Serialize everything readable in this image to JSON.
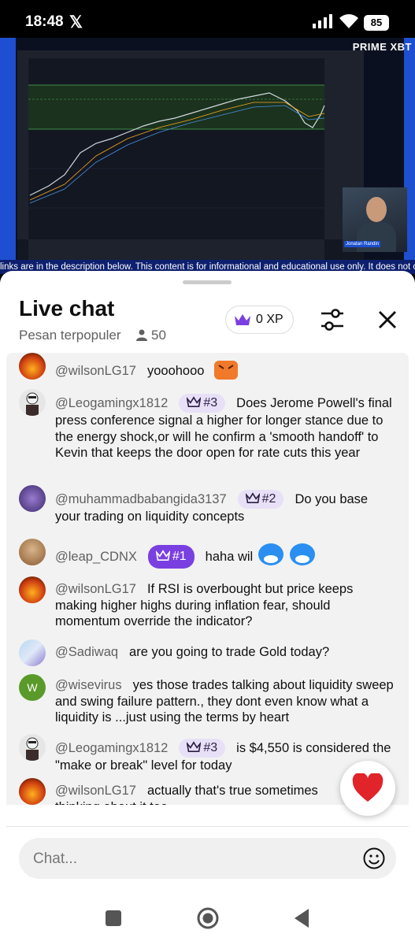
{
  "status_bar": {
    "time": "18:48",
    "battery": "85"
  },
  "video": {
    "brand": "PRIME XBT",
    "ticker": "links are in the description below. This content is for informational and educational use only. It does not con",
    "presenter_name": "Jonatan Randin"
  },
  "chat": {
    "title": "Live chat",
    "filter_label": "Pesan terpopuler",
    "viewer_count": "50",
    "xp_label": "0 XP",
    "messages": [
      {
        "author": "@wilsonLG17",
        "badge": "",
        "text": "yooohooo"
      },
      {
        "author": "@Leogamingx1812",
        "badge": "#3",
        "text": "Does Jerome Powell's final press conference signal a higher for longer stance due to the energy shock,or will he confirm a 'smooth handoff' to Kevin that keeps the door open for rate cuts this year"
      },
      {
        "author": "@muhammadbabangida3137",
        "badge": "#2",
        "text": "Do you base your trading on liquidity concepts"
      },
      {
        "author": "@leap_CDNX",
        "badge": "#1",
        "text": "haha wil"
      },
      {
        "author": "@wilsonLG17",
        "badge": "",
        "text": "If RSI is overbought but price keeps making higher highs during inflation fear, should momentum override the indicator?"
      },
      {
        "author": "@Sadiwaq",
        "badge": "",
        "text": "are you going to trade Gold today?"
      },
      {
        "author": "@wisevirus",
        "badge": "",
        "avatar_letter": "W",
        "text": "yes those trades talking about liquidity sweep and swing failure pattern., they dont even know what a liquidity is ...just using the terms by heart"
      },
      {
        "author": "@Leogamingx1812",
        "badge": "#3",
        "text": "is $4,550 is considered the \"make or break\" level for today"
      },
      {
        "author": "@wilsonLG17",
        "badge": "",
        "text": "actually that's true sometimes thinking about it too"
      }
    ],
    "input_placeholder": "Chat..."
  },
  "colors": {
    "badge_light": "#e8e0f7",
    "badge_dark": "#7a3fe0",
    "heart": "#e0242a",
    "ticker_bg": "#0d1f6e"
  }
}
